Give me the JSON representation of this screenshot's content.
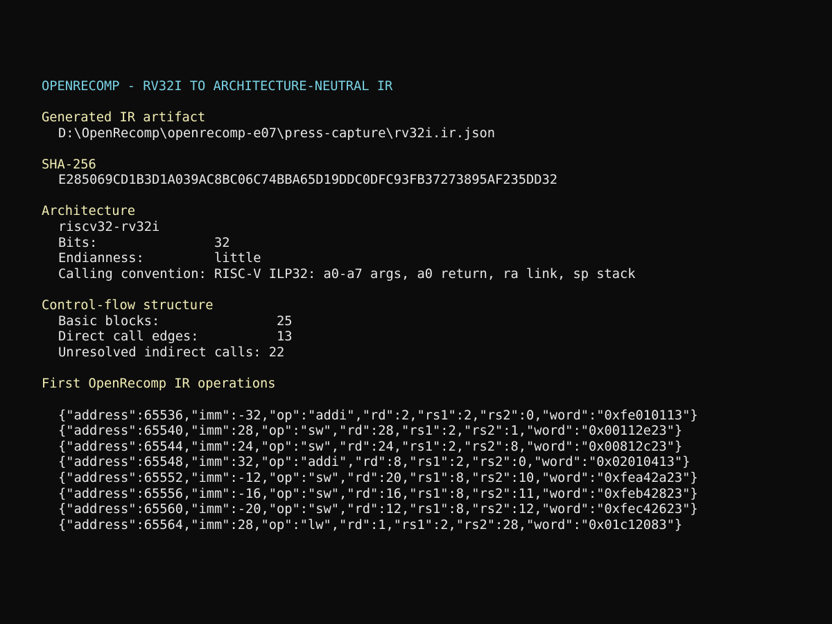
{
  "title": "OPENRECOMP - RV32I TO ARCHITECTURE-NEUTRAL IR",
  "artifact": {
    "heading": "Generated IR artifact",
    "path": "D:\\OpenRecomp\\openrecomp-e07\\press-capture\\rv32i.ir.json"
  },
  "sha": {
    "heading": "SHA-256",
    "value": "E285069CD1B3D1A039AC8BC06C74BBA65D19DDC0DFC93FB37273895AF235DD32"
  },
  "architecture": {
    "heading": "Architecture",
    "name": "riscv32-rv32i",
    "bits_line": "Bits:               32",
    "endianness_line": "Endianness:         little",
    "calling_convention_line": "Calling convention: RISC-V ILP32: a0-a7 args, a0 return, ra link, sp stack"
  },
  "control_flow": {
    "heading": "Control-flow structure",
    "basic_blocks_line": "Basic blocks:               25",
    "direct_call_edges_line": "Direct call edges:          13",
    "unresolved_indirect_calls_line": "Unresolved indirect calls: 22"
  },
  "ir_operations": {
    "heading": "First OpenRecomp IR operations",
    "lines": [
      "{\"address\":65536,\"imm\":-32,\"op\":\"addi\",\"rd\":2,\"rs1\":2,\"rs2\":0,\"word\":\"0xfe010113\"}",
      "{\"address\":65540,\"imm\":28,\"op\":\"sw\",\"rd\":28,\"rs1\":2,\"rs2\":1,\"word\":\"0x00112e23\"}",
      "{\"address\":65544,\"imm\":24,\"op\":\"sw\",\"rd\":24,\"rs1\":2,\"rs2\":8,\"word\":\"0x00812c23\"}",
      "{\"address\":65548,\"imm\":32,\"op\":\"addi\",\"rd\":8,\"rs1\":2,\"rs2\":0,\"word\":\"0x02010413\"}",
      "{\"address\":65552,\"imm\":-12,\"op\":\"sw\",\"rd\":20,\"rs1\":8,\"rs2\":10,\"word\":\"0xfea42a23\"}",
      "{\"address\":65556,\"imm\":-16,\"op\":\"sw\",\"rd\":16,\"rs1\":8,\"rs2\":11,\"word\":\"0xfeb42823\"}",
      "{\"address\":65560,\"imm\":-20,\"op\":\"sw\",\"rd\":12,\"rs1\":8,\"rs2\":12,\"word\":\"0xfec42623\"}",
      "{\"address\":65564,\"imm\":28,\"op\":\"lw\",\"rd\":1,\"rs1\":2,\"rs2\":28,\"word\":\"0x01c12083\"}"
    ]
  },
  "colors": {
    "background": "#0c0c0c",
    "title": "#7ad3e6",
    "heading": "#f2eeb4",
    "text": "#e8e8e8"
  }
}
